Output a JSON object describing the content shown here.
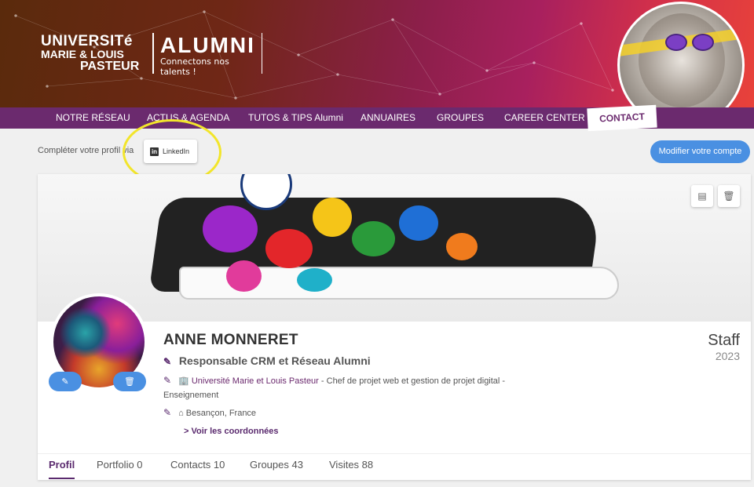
{
  "header": {
    "university_line1": "UNIVERSITé",
    "university_line2": "MARIE & LOUIS",
    "university_line3": "PASTEUR",
    "alumni_title": "ALUMNI",
    "alumni_tagline": "Connectons nos talents !"
  },
  "nav": {
    "items": [
      {
        "label": "NOTRE RÉSEAU"
      },
      {
        "label": "ACTUS & AGENDA"
      },
      {
        "label": "TUTOS & TIPS Alumni"
      },
      {
        "label": "ANNUAIRES"
      },
      {
        "label": "GROUPES"
      },
      {
        "label": "CAREER CENTER"
      }
    ],
    "contact": "CONTACT"
  },
  "profile_completion": {
    "label": "Compléter votre profil via",
    "linkedin_icon": "in",
    "linkedin_label": "LinkedIn",
    "edit_account": "Modifier votre compte"
  },
  "profile": {
    "name": "ANNE MONNERET",
    "role": "Responsable CRM et Réseau Alumni",
    "organization": "Université Marie et Louis Pasteur",
    "organization_detail": " - Chef de projet web et gestion de projet digital - Enseignement",
    "location": "Besançon, France",
    "see_coordinates": "> Voir les coordonnées",
    "status": "Staff",
    "year": "2023"
  },
  "tabs": [
    {
      "label": "Profil"
    },
    {
      "label": "Portfolio 0"
    },
    {
      "label": "Contacts 10"
    },
    {
      "label": "Groupes 43"
    },
    {
      "label": "Visites 88"
    }
  ],
  "colors": {
    "brand_purple": "#6b2a6e",
    "accent_blue": "#4a90e2",
    "highlight_yellow": "#f2e52b"
  }
}
